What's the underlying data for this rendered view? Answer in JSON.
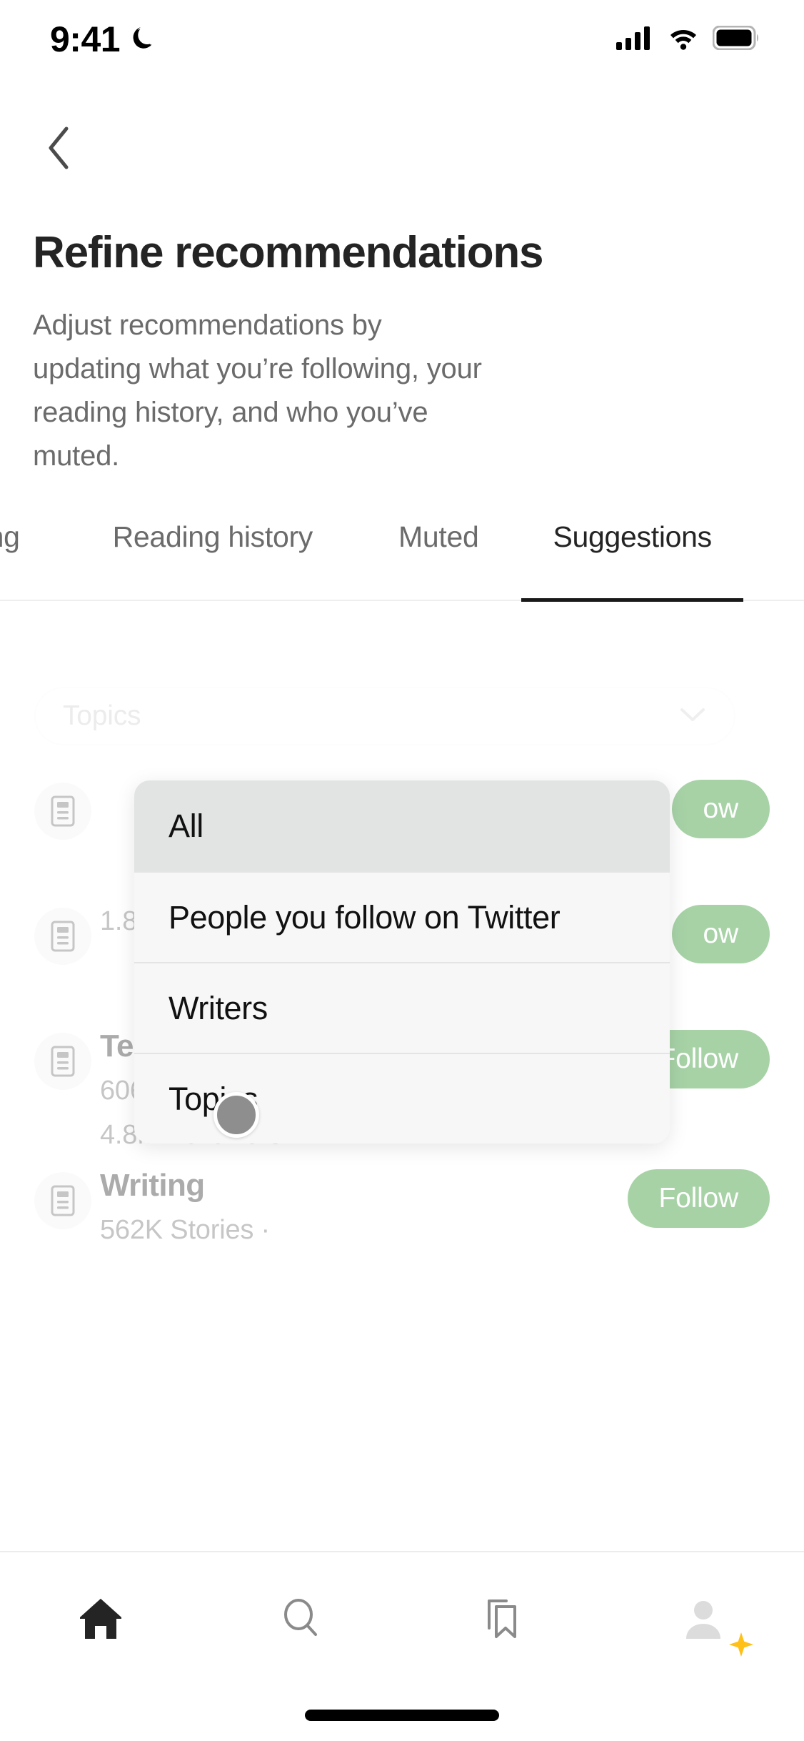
{
  "status_bar": {
    "time": "9:41",
    "dnd_icon": "crescent-moon-icon",
    "signal_icon": "cellular-signal-icon",
    "wifi_icon": "wifi-icon",
    "battery_icon": "battery-full-icon"
  },
  "header": {
    "back_icon": "chevron-left-icon",
    "title": "Refine recommendations",
    "description": "Adjust recommendations by updating what you’re following, your reading history, and who you’ve muted."
  },
  "tabs": [
    {
      "label": "owing",
      "active": false,
      "clipped": true
    },
    {
      "label": "Reading history",
      "active": false
    },
    {
      "label": "Muted",
      "active": false
    },
    {
      "label": "Suggestions",
      "active": true
    }
  ],
  "filter_select": {
    "value": "Topics",
    "placeholder": "Topics",
    "chevron_icon": "chevron-down-icon"
  },
  "dropdown": {
    "open": true,
    "selected": "All",
    "options": [
      "All",
      "People you follow on Twitter",
      "Writers",
      "Topics"
    ]
  },
  "touch_indicator": {
    "name": "touch-cursor",
    "color": "#8e8e8e"
  },
  "suggestions": [
    {
      "name": "",
      "meta_line1": "",
      "meta_line2": "",
      "follow_label": "ow",
      "icon": "topic-document-icon",
      "obscured": true
    },
    {
      "name": "",
      "meta_line1": "",
      "meta_line2": "1.8M Followers",
      "follow_label": "ow",
      "icon": "topic-document-icon",
      "obscured": true
    },
    {
      "name": "Technology",
      "meta_line1": "606K Stories ·",
      "meta_line2": "4.8M Followers",
      "follow_label": "Follow",
      "icon": "topic-document-icon",
      "obscured": false
    },
    {
      "name": "Writing",
      "meta_line1": "562K Stories ·",
      "meta_line2": "",
      "follow_label": "Follow",
      "icon": "topic-document-icon",
      "obscured": false
    }
  ],
  "bottom_nav": [
    {
      "icon": "home-icon",
      "active": true
    },
    {
      "icon": "search-icon",
      "active": false
    },
    {
      "icon": "bookmark-icon",
      "active": false
    },
    {
      "icon": "profile-avatar-icon",
      "active": false,
      "badge_icon": "sparkle-icon"
    }
  ],
  "colors": {
    "accent_green": "#1a8917",
    "text_primary": "#242424",
    "text_secondary": "#6b6b6b",
    "sparkle_yellow": "#ffc017"
  }
}
